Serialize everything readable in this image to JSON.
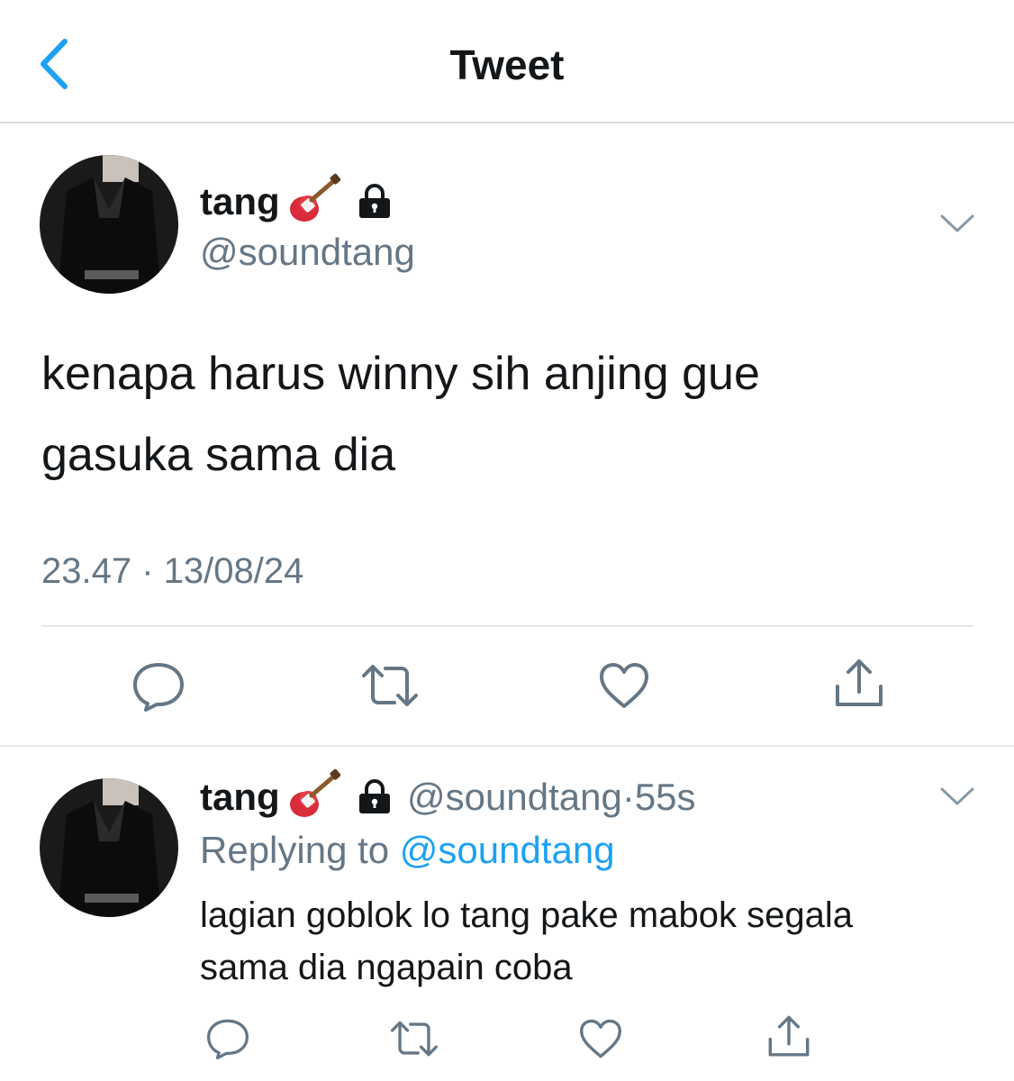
{
  "header": {
    "title": "Tweet",
    "back_icon": "chevron-left-icon",
    "accent": "#1da1f2"
  },
  "tweet": {
    "display_name": "tang",
    "name_emoji_icon": "guitar-icon",
    "protected_icon": "lock-icon",
    "handle": "@soundtang",
    "menu_icon": "chevron-down-icon",
    "text_line1": "kenapa harus winny sih anjing gue",
    "text_line2": "gasuka sama dia",
    "timestamp": "23.47 · 13/08/24",
    "actions": [
      "reply-icon",
      "retweet-icon",
      "like-icon",
      "share-icon"
    ]
  },
  "reply": {
    "display_name": "tang",
    "handle": "@soundtang",
    "separator": "·",
    "age": "55s",
    "replying_prefix": "Replying to",
    "replying_handle": "@soundtang",
    "text_line1": "lagian goblok lo tang pake mabok segala",
    "text_line2": "sama dia ngapain coba",
    "actions": [
      "reply-icon",
      "retweet-icon",
      "like-icon",
      "share-icon"
    ]
  },
  "colors": {
    "text": "#14171a",
    "secondary": "#657786",
    "link": "#1da1f2",
    "divider": "#e1e8ed"
  }
}
